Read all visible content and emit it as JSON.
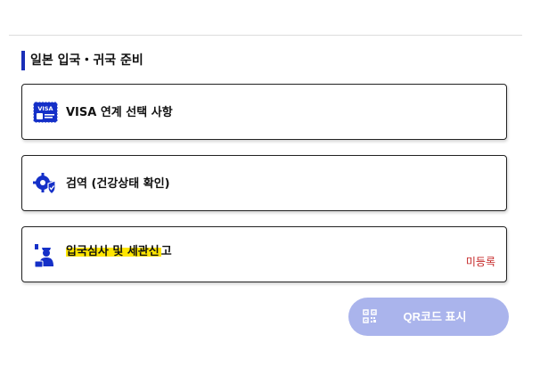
{
  "section": {
    "title": "일본 입국・귀국 준비"
  },
  "cards": [
    {
      "label": "VISA 연계 선택 사항",
      "icon": "visa-card-icon"
    },
    {
      "label": "검역 (건강상태 확인)",
      "icon": "quarantine-gear-shield-icon"
    },
    {
      "label_highlighted": "입국심사 및 세관신",
      "label_rest": "고",
      "icon": "immigration-officer-icon",
      "status": "미등록"
    }
  ],
  "qr_button": {
    "label": "QR코드 표시",
    "icon": "qr-code-icon"
  },
  "colors": {
    "accent": "#1a2fb8",
    "icon_blue": "#1530c8",
    "highlight": "#ffe600",
    "status_red": "#c62828",
    "button_bg": "#aab4ec"
  }
}
